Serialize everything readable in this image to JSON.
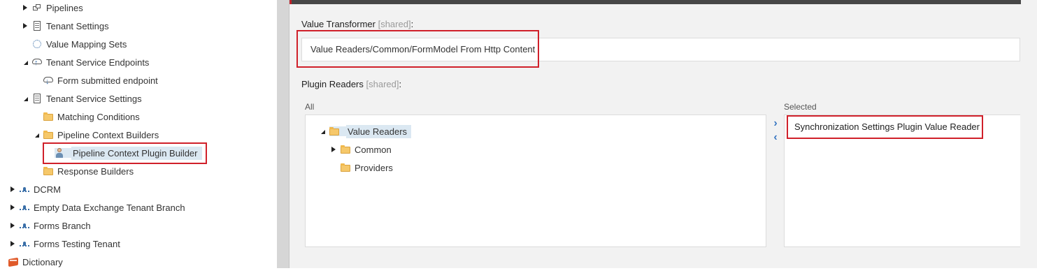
{
  "tree": {
    "nodes": [
      {
        "label": "Pipelines",
        "icon": "pipeline-icon",
        "state": "collapsed"
      },
      {
        "label": "Tenant Settings",
        "icon": "settings-document-icon",
        "state": "collapsed"
      },
      {
        "label": "Value Mapping Sets",
        "icon": "dotted-circle-icon",
        "state": "none"
      },
      {
        "label": "Tenant Service Endpoints",
        "icon": "cloud-upload-icon",
        "state": "expanded"
      },
      {
        "label": "Form submitted endpoint",
        "icon": "cloud-download-icon",
        "state": "none"
      },
      {
        "label": "Tenant Service Settings",
        "icon": "settings-document-icon",
        "state": "expanded"
      },
      {
        "label": "Matching Conditions",
        "icon": "folder-icon",
        "state": "none"
      },
      {
        "label": "Pipeline Context Builders",
        "icon": "folder-icon",
        "state": "expanded"
      },
      {
        "label": "Pipeline Context Plugin Builder",
        "icon": "person-icon",
        "state": "none",
        "selected": true
      },
      {
        "label": "Response Builders",
        "icon": "folder-icon",
        "state": "none"
      },
      {
        "label": "DCRM",
        "icon": "branch-icon",
        "state": "collapsed"
      },
      {
        "label": "Empty Data Exchange Tenant Branch",
        "icon": "branch-icon",
        "state": "collapsed"
      },
      {
        "label": "Forms Branch",
        "icon": "branch-icon",
        "state": "collapsed"
      },
      {
        "label": "Forms Testing Tenant",
        "icon": "branch-icon",
        "state": "collapsed"
      },
      {
        "label": "Dictionary",
        "icon": "dictionary-book-icon",
        "state": "none"
      }
    ]
  },
  "editor": {
    "value_transformer": {
      "label": "Value Transformer",
      "shared": "[shared]",
      "suffix": ":",
      "value": "Value Readers/Common/FormModel From Http Content"
    },
    "plugin_readers": {
      "label": "Plugin Readers",
      "shared": "[shared]",
      "suffix": ":",
      "all_caption": "All",
      "selected_caption": "Selected",
      "all_tree": [
        {
          "label": "Value Readers",
          "state": "expanded",
          "selected": true
        },
        {
          "label": "Common",
          "state": "collapsed"
        },
        {
          "label": "Providers",
          "state": "none"
        }
      ],
      "selected_items": [
        "Synchronization Settings Plugin Value Reader"
      ],
      "move_right": "›",
      "move_left": "‹"
    }
  },
  "colors": {
    "highlight": "#d0202a",
    "selection": "#dbe8f2",
    "accent": "#3a78c2",
    "topbar": "#474747"
  }
}
